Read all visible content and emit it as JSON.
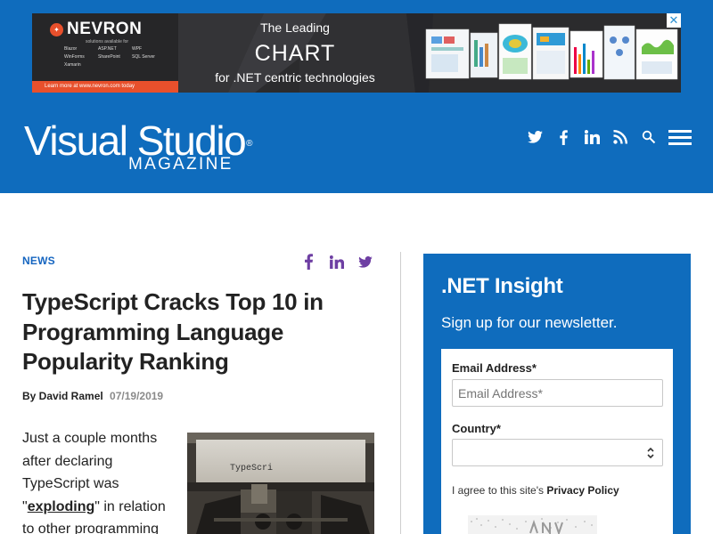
{
  "ad": {
    "brand": "NEVRON",
    "tagline_small": "solutions available for",
    "platforms": [
      "Blazor",
      "ASP.NET",
      "WPF",
      "WinForms",
      "SharePoint",
      "SQL Server",
      "Xamarin"
    ],
    "cta": "Learn more at www.nevron.com today",
    "line1": "The Leading",
    "line2": "CHART",
    "line3": "for .NET centric technologies",
    "close": "✕"
  },
  "header": {
    "brand_main": "Visual Studio",
    "brand_reg": "®",
    "brand_sub": "MAGAZINE",
    "icons": [
      "twitter-icon",
      "facebook-icon",
      "linkedin-icon",
      "rss-icon",
      "search-icon",
      "menu-icon"
    ]
  },
  "article": {
    "section": "NEWS",
    "headline": "TypeScript Cracks Top 10 in Programming Language Popularity Ranking",
    "author": "By David Ramel",
    "date": "07/19/2019",
    "body_before": "Just a couple months after declaring TypeScript was \"",
    "body_link": "exploding",
    "body_after": "\" in relation to other programming",
    "image_text": "TypeScri"
  },
  "newsletter": {
    "title": ".NET Insight",
    "subtitle": "Sign up for our newsletter.",
    "email_label": "Email Address*",
    "email_placeholder": "Email Address*",
    "country_label": "Country*",
    "country_value": "",
    "agree_prefix": "I agree to this site's ",
    "agree_link": "Privacy Policy"
  },
  "colors": {
    "brand_blue": "#0f6cbd",
    "section_blue": "#1565c0",
    "share_purple": "#6e3fa3"
  }
}
